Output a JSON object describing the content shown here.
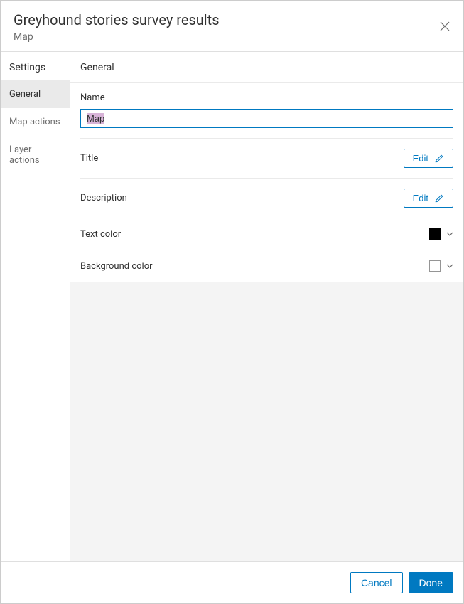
{
  "header": {
    "title": "Greyhound stories survey results",
    "subtitle": "Map"
  },
  "sidebar": {
    "heading": "Settings",
    "items": [
      {
        "label": "General",
        "active": true
      },
      {
        "label": "Map actions",
        "active": false
      },
      {
        "label": "Layer actions",
        "active": false
      }
    ]
  },
  "panel": {
    "heading": "General",
    "name_label": "Name",
    "name_value": "Map",
    "title_label": "Title",
    "description_label": "Description",
    "edit_label": "Edit",
    "text_color_label": "Text color",
    "text_color_value": "#000000",
    "bg_color_label": "Background color",
    "bg_color_value": "#ffffff"
  },
  "footer": {
    "cancel": "Cancel",
    "done": "Done"
  }
}
